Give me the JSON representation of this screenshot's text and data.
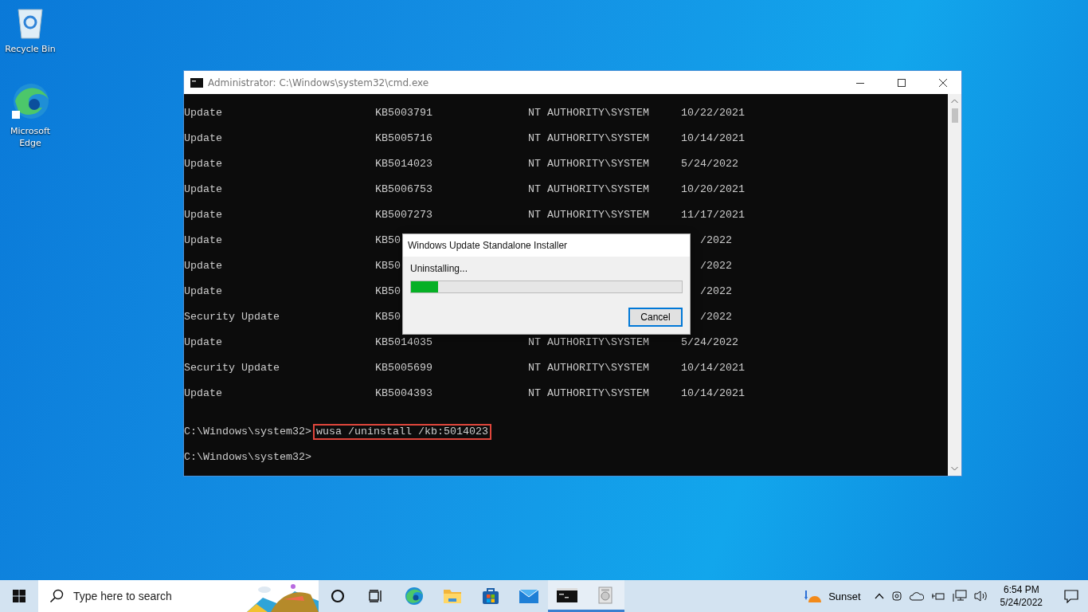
{
  "desktop_icons": [
    {
      "kind": "recycle",
      "label": "Recycle Bin"
    },
    {
      "kind": "edge",
      "label": "Microsoft Edge"
    }
  ],
  "console_window": {
    "title": "Administrator: C:\\Windows\\system32\\cmd.exe",
    "rows": [
      {
        "kind": "full",
        "cells": [
          "Update",
          "KB5003791",
          "NT AUTHORITY\\SYSTEM",
          "10/22/2021"
        ]
      },
      {
        "kind": "full",
        "cells": [
          "Update",
          "KB5005716",
          "NT AUTHORITY\\SYSTEM",
          "10/14/2021"
        ]
      },
      {
        "kind": "full",
        "cells": [
          "Update",
          "KB5014023",
          "NT AUTHORITY\\SYSTEM",
          "5/24/2022"
        ]
      },
      {
        "kind": "full",
        "cells": [
          "Update",
          "KB5006753",
          "NT AUTHORITY\\SYSTEM",
          "10/20/2021"
        ]
      },
      {
        "kind": "full",
        "cells": [
          "Update",
          "KB5007273",
          "NT AUTHORITY\\SYSTEM",
          "11/17/2021"
        ]
      },
      {
        "kind": "partial",
        "cells": [
          "Update",
          "KB50",
          "/2022"
        ]
      },
      {
        "kind": "partial",
        "cells": [
          "Update",
          "KB50",
          "/2022"
        ]
      },
      {
        "kind": "partial",
        "cells": [
          "Update",
          "KB50",
          "/2022"
        ]
      },
      {
        "kind": "partial",
        "cells": [
          "Security Update",
          "KB50",
          "/2022"
        ]
      },
      {
        "kind": "full",
        "cells": [
          "Update",
          "KB5014035",
          "NT AUTHORITY\\SYSTEM",
          "5/24/2022"
        ]
      },
      {
        "kind": "full",
        "cells": [
          "Security Update",
          "KB5005699",
          "NT AUTHORITY\\SYSTEM",
          "10/14/2021"
        ]
      },
      {
        "kind": "full",
        "cells": [
          "Update",
          "KB5004393",
          "NT AUTHORITY\\SYSTEM",
          "10/14/2021"
        ]
      }
    ],
    "prompt": "C:\\Windows\\system32>",
    "command": "wusa /uninstall /kb:5014023",
    "last_prompt": "C:\\Windows\\system32>"
  },
  "dialog": {
    "title": "Windows Update Standalone Installer",
    "status": "Uninstalling...",
    "level": 0.1,
    "button": "Cancel"
  },
  "taskbar": {
    "search_placeholder": "Type here to search",
    "apps": [
      {
        "kind": "cortana",
        "active": false
      },
      {
        "kind": "taskview",
        "active": false
      },
      {
        "kind": "edge",
        "active": false
      },
      {
        "kind": "explorer",
        "active": false
      },
      {
        "kind": "store",
        "active": false
      },
      {
        "kind": "mail",
        "active": false
      },
      {
        "kind": "cmd",
        "active": true
      },
      {
        "kind": "installer",
        "active": true
      }
    ],
    "weather": "Sunset",
    "time": "6:54 PM",
    "date": "5/24/2022"
  }
}
